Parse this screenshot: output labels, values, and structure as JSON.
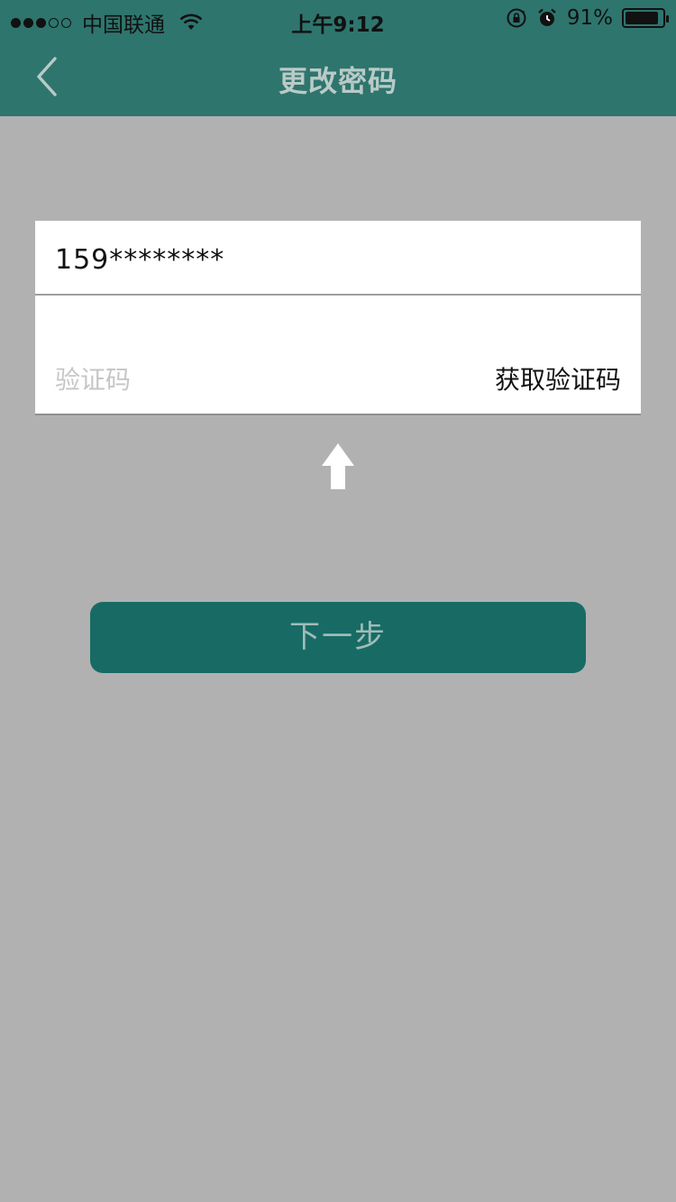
{
  "status_bar": {
    "carrier": "中国联通",
    "time": "上午9:12",
    "battery_percent": "91%",
    "battery_level": 0.91,
    "signal_dots_filled": 3,
    "signal_dots_total": 5,
    "icons": [
      "wifi-icon",
      "rotation-lock-icon",
      "alarm-icon",
      "battery-icon"
    ]
  },
  "nav": {
    "title": "更改密码",
    "back_icon": "chevron-left-icon"
  },
  "form": {
    "phone_value": "159********",
    "code_placeholder": "验证码",
    "get_code_label": "获取验证码"
  },
  "overlay": {
    "arrow_icon": "arrow-up-icon"
  },
  "actions": {
    "next_label": "下一步"
  },
  "colors": {
    "header": "#2e756e",
    "background": "#b1b1b1",
    "button": "#186b65",
    "button_text": "#a0bcb8",
    "nav_title": "#b9cac7"
  }
}
